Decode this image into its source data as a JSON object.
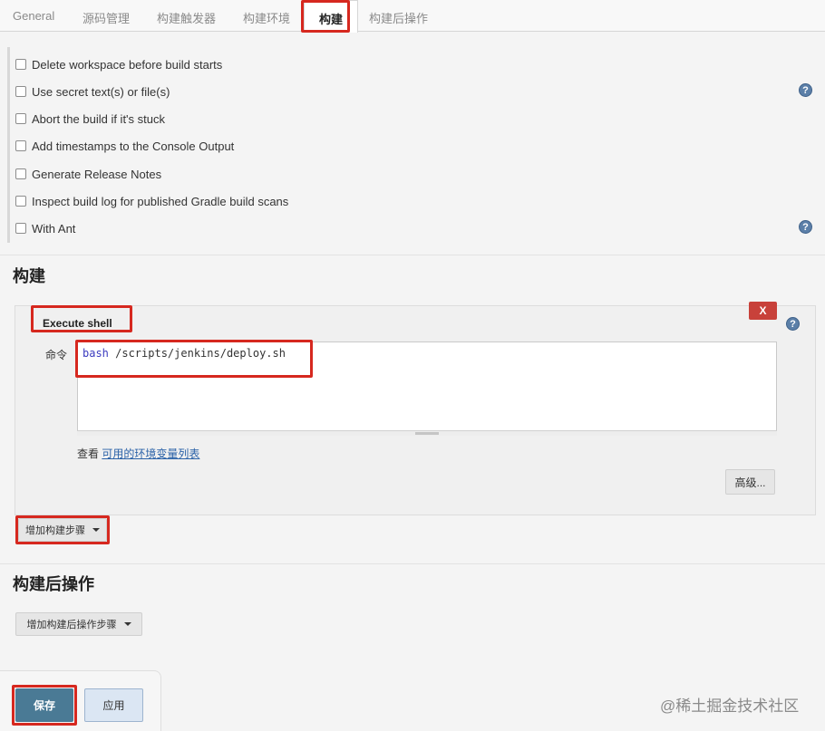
{
  "tabs": [
    {
      "label": "General"
    },
    {
      "label": "源码管理"
    },
    {
      "label": "构建触发器"
    },
    {
      "label": "构建环境"
    },
    {
      "label": "构建",
      "active": true
    },
    {
      "label": "构建后操作"
    }
  ],
  "build_env": {
    "options": [
      {
        "label": "Delete workspace before build starts",
        "checked": false
      },
      {
        "label": "Use secret text(s) or file(s)",
        "checked": false,
        "help": true
      },
      {
        "label": "Abort the build if it's stuck",
        "checked": false
      },
      {
        "label": "Add timestamps to the Console Output",
        "checked": false
      },
      {
        "label": "Generate Release Notes",
        "checked": false
      },
      {
        "label": "Inspect build log for published Gradle build scans",
        "checked": false
      },
      {
        "label": "With Ant",
        "checked": false,
        "help": true
      }
    ]
  },
  "build": {
    "title": "构建",
    "step": {
      "title": "Execute shell",
      "delete_label": "X",
      "command_label": "命令",
      "command_keyword": "bash",
      "command_rest": " /scripts/jenkins/deploy.sh",
      "env_prefix": "查看 ",
      "env_link": "可用的环境变量列表",
      "advanced_label": "高级..."
    },
    "add_step_label": "增加构建步骤"
  },
  "post_build": {
    "title": "构建后操作",
    "add_step_label": "增加构建后操作步骤"
  },
  "footer": {
    "save_label": "保存",
    "apply_label": "应用"
  },
  "watermark": "@稀土掘金技术社区",
  "colors": {
    "highlight": "#d6281f",
    "delete": "#c8413a",
    "save": "#4a7a95",
    "help": "#5b7fa8",
    "link": "#2b62a8"
  },
  "icons": {
    "help": "question-circle-icon",
    "dropdown": "caret-down-icon"
  }
}
